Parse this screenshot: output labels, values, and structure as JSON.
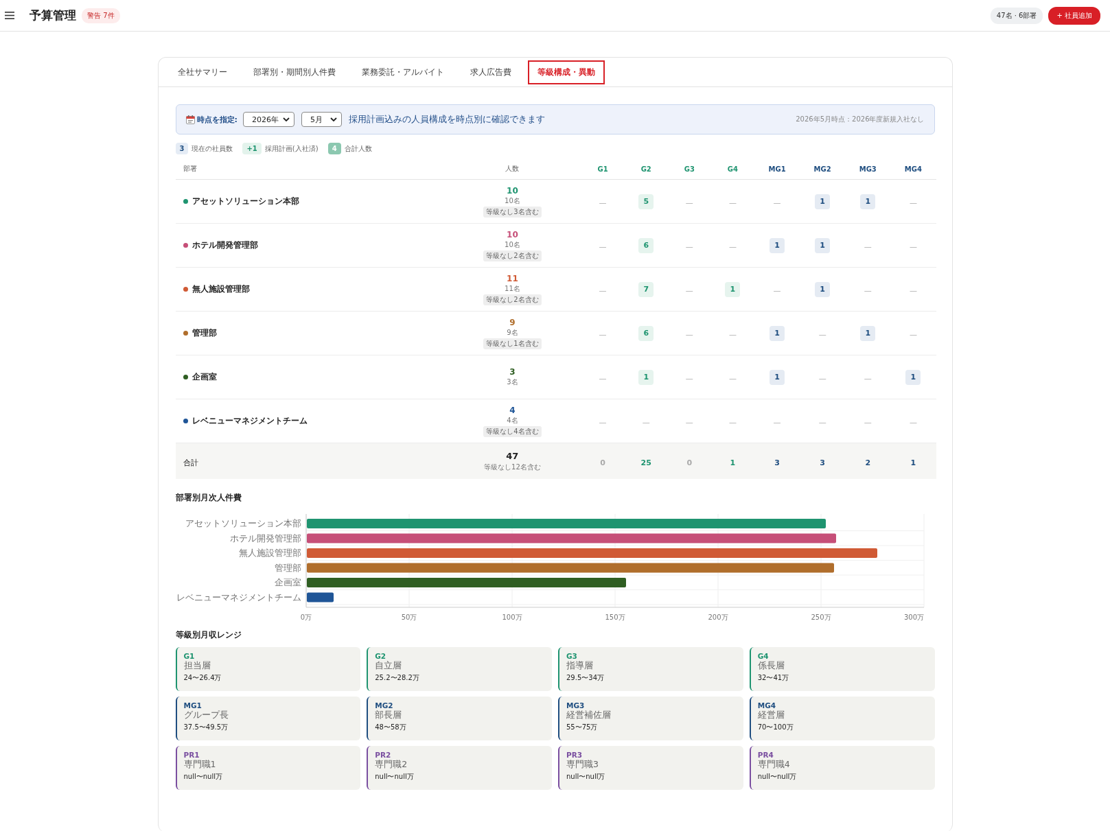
{
  "header": {
    "title": "予算管理",
    "warning_badge": "警告 7件",
    "summary_pill": "47名 · 6部署",
    "add_button": "+ 社員追加"
  },
  "tabs": [
    {
      "label": "全社サマリー",
      "selected": false
    },
    {
      "label": "部署別・期間別人件費",
      "selected": false
    },
    {
      "label": "業務委託・アルバイト",
      "selected": false
    },
    {
      "label": "求人広告費",
      "selected": false
    },
    {
      "label": "等級構成・異動",
      "selected": true
    }
  ],
  "filter": {
    "label": "時点を指定:",
    "year": "2026年",
    "month": "5月",
    "hint": "採用計画込みの人員構成を時点別に確認できます",
    "status": "2026年5月時点：2026年度新規入社なし"
  },
  "legend": [
    {
      "kind": "current",
      "badge": "3",
      "label": "現在の社員数"
    },
    {
      "kind": "plan",
      "badge": "+1",
      "label": "採用計画(入社済)"
    },
    {
      "kind": "total",
      "badge": "4",
      "label": "合計人数"
    }
  ],
  "table": {
    "columns": [
      {
        "label": "部署",
        "kind": "name"
      },
      {
        "label": "人数",
        "kind": "count"
      },
      {
        "label": "G1",
        "kind": "g"
      },
      {
        "label": "G2",
        "kind": "g"
      },
      {
        "label": "G3",
        "kind": "g"
      },
      {
        "label": "G4",
        "kind": "g"
      },
      {
        "label": "MG1",
        "kind": "mg"
      },
      {
        "label": "MG2",
        "kind": "mg"
      },
      {
        "label": "MG3",
        "kind": "mg"
      },
      {
        "label": "MG4",
        "kind": "mg"
      }
    ],
    "rows": [
      {
        "color": "#1f9470",
        "cells": [
          "アセットソリューション本部",
          "10",
          "—",
          "5",
          "—",
          "—",
          "—",
          "1",
          "1",
          "—"
        ],
        "sub": "10名",
        "note": "等級なし3名含む"
      },
      {
        "color": "#c64f78",
        "cells": [
          "ホテル開発管理部",
          "10",
          "—",
          "6",
          "—",
          "—",
          "1",
          "1",
          "—",
          "—"
        ],
        "sub": "10名",
        "note": "等級なし2名含む"
      },
      {
        "color": "#d05a35",
        "cells": [
          "無人施設管理部",
          "11",
          "—",
          "7",
          "—",
          "1",
          "—",
          "1",
          "—",
          "—"
        ],
        "sub": "11名",
        "note": "等級なし2名含む"
      },
      {
        "color": "#b06e2c",
        "cells": [
          "管理部",
          "9",
          "—",
          "6",
          "—",
          "—",
          "1",
          "—",
          "1",
          "—"
        ],
        "sub": "9名",
        "note": "等級なし1名含む"
      },
      {
        "color": "#2f5e22",
        "cells": [
          "企画室",
          "3",
          "—",
          "1",
          "—",
          "—",
          "1",
          "—",
          "—",
          "1"
        ],
        "sub": "3名"
      },
      {
        "color": "#1f5597",
        "cells": [
          "レベニューマネジメントチーム",
          "4",
          "—",
          "—",
          "—",
          "—",
          "—",
          "—",
          "—",
          "—"
        ],
        "sub": "4名",
        "note": "等級なし4名含む"
      }
    ],
    "total_row": {
      "cells": [
        "合計",
        "47",
        "0",
        "25",
        "0",
        "1",
        "3",
        "3",
        "2",
        "1"
      ],
      "note": "等級なし12名含む",
      "muted": [
        false,
        false,
        true,
        false,
        true,
        false,
        false,
        false,
        false,
        false
      ]
    }
  },
  "cost_chart": {
    "title": "部署別月次人件費",
    "chart_data": {
      "type": "bar",
      "orientation": "horizontal",
      "grid": true,
      "categories": [
        "アセットソリューション本部",
        "ホテル開発管理部",
        "無人施設管理部",
        "管理部",
        "企画室",
        "レベニューマネジメントチーム"
      ],
      "series": [
        {
          "values": [
            252,
            257,
            277,
            256,
            155,
            13
          ]
        }
      ],
      "colors": [
        "#1f9470",
        "#c64f78",
        "#d05a35",
        "#b06e2c",
        "#2f5e22",
        "#1f5597"
      ],
      "xlim": [
        0,
        300
      ],
      "xticks": [
        {
          "value": 0,
          "label": "0万"
        },
        {
          "value": 50,
          "label": "50万"
        },
        {
          "value": 100,
          "label": "100万"
        },
        {
          "value": 150,
          "label": "150万"
        },
        {
          "value": 200,
          "label": "200万"
        },
        {
          "value": 250,
          "label": "250万"
        },
        {
          "value": 300,
          "label": "300万"
        }
      ]
    }
  },
  "grades": {
    "title": "等級別月収レンジ",
    "items": [
      {
        "kind": "g",
        "code": "G1",
        "name": "担当層",
        "range": "24〜26.4万"
      },
      {
        "kind": "g",
        "code": "G2",
        "name": "自立層",
        "range": "25.2〜28.2万"
      },
      {
        "kind": "g",
        "code": "G3",
        "name": "指導層",
        "range": "29.5〜34万"
      },
      {
        "kind": "g",
        "code": "G4",
        "name": "係長層",
        "range": "32〜41万"
      },
      {
        "kind": "mg",
        "code": "MG1",
        "name": "グループ長",
        "range": "37.5〜49.5万"
      },
      {
        "kind": "mg",
        "code": "MG2",
        "name": "部長層",
        "range": "48〜58万"
      },
      {
        "kind": "mg",
        "code": "MG3",
        "name": "経営補佐層",
        "range": "55〜75万"
      },
      {
        "kind": "mg",
        "code": "MG4",
        "name": "経営層",
        "range": "70〜100万"
      },
      {
        "kind": "pr",
        "code": "PR1",
        "name": "専門職1",
        "range": "null〜null万"
      },
      {
        "kind": "pr",
        "code": "PR2",
        "name": "専門職2",
        "range": "null〜null万"
      },
      {
        "kind": "pr",
        "code": "PR3",
        "name": "専門職3",
        "range": "null〜null万"
      },
      {
        "kind": "pr",
        "code": "PR4",
        "name": "専門職4",
        "range": "null〜null万"
      }
    ]
  }
}
